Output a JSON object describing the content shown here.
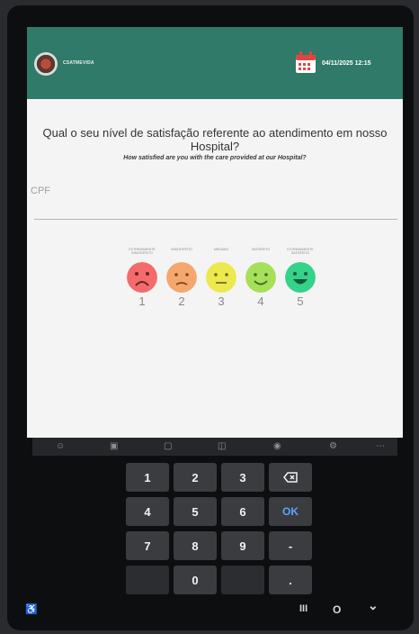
{
  "header": {
    "org_name": "CSATMEVIDA",
    "datetime": "04/11/2025 12:15",
    "logo_icon": "hospital-logo",
    "calendar_icon": "calendar-icon",
    "color": "#2f7a68"
  },
  "survey": {
    "question": "Qual o seu nível de satisfação referente ao atendimento em nosso Hospital?",
    "subtitle": "How satisfied are you with the care provided at our Hospital?",
    "cpf_label": "CPF",
    "options": [
      {
        "label": "Extremamente insatisfeito",
        "number": "1",
        "face": "very-sad-face-icon",
        "color": "#f36b6b"
      },
      {
        "label": "Insatisfeito",
        "number": "2",
        "face": "sad-face-icon",
        "color": "#f6a76e"
      },
      {
        "label": "Mediano",
        "number": "3",
        "face": "neutral-face-icon",
        "color": "#ece84e"
      },
      {
        "label": "Satisfeito",
        "number": "4",
        "face": "smile-face-icon",
        "color": "#a6df5a"
      },
      {
        "label": "Extremamente satisfeito",
        "number": "5",
        "face": "big-smile-face-icon",
        "color": "#35d28a"
      }
    ]
  },
  "toolbar_icons": [
    "emoji-icon",
    "sticker-icon",
    "clipboard-icon",
    "translate-icon",
    "mic-icon",
    "settings-icon",
    "more-icon"
  ],
  "keypad": {
    "keys": [
      "1",
      "2",
      "3",
      "4",
      "5",
      "6",
      "7",
      "8",
      "9",
      "0"
    ],
    "backspace_icon": "backspace-icon",
    "ok_label": "OK",
    "minus_label": "-",
    "dot_label": "."
  },
  "system_nav": {
    "accessibility_icon": "accessibility-icon",
    "recents_label": "III",
    "home_label": "O",
    "back_label": "⌄"
  }
}
